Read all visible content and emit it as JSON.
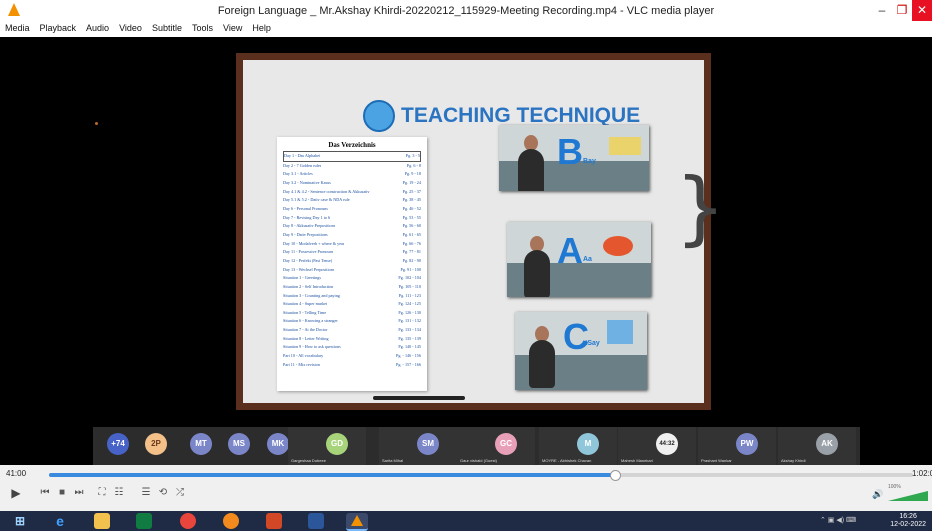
{
  "window": {
    "title": "Foreign Language _ Mr.Akshay Khirdi-20220212_115929-Meeting Recording.mp4 - VLC media player",
    "app_icon": "vlc-cone-icon",
    "minimize": "–",
    "maximize": "❐",
    "close": "✕"
  },
  "menu": [
    "Media",
    "Playback",
    "Audio",
    "Video",
    "Subtitle",
    "Tools",
    "View",
    "Help"
  ],
  "slide": {
    "heading": "TEACHING TECHNIQUE",
    "toc_title": "Das Verzeichnis",
    "toc": [
      {
        "l": "Day 1 - Das Alphabet",
        "r": "Pg. 3 - 5"
      },
      {
        "l": "Day 2 - 7 Golden rules",
        "r": "Pg. 6 - 8"
      },
      {
        "l": "Day 3.1 - Articles",
        "r": "Pg. 9 - 18"
      },
      {
        "l": "Day 3.2 - Nominative Kasus",
        "r": "Pg. 19 - 24"
      },
      {
        "l": "Day 4.1 & 4.2 - Sentence construction & Akkusativ",
        "r": "Pg. 25 - 37"
      },
      {
        "l": "Day 5.1 & 5.2 - Dativ case & NDA rule",
        "r": "Pg. 38 - 45"
      },
      {
        "l": "Day 6 - Personal Pronouns",
        "r": "Pg. 46 - 52"
      },
      {
        "l": "Day 7 - Revising Day 1 to 6",
        "r": "Pg. 53 - 55"
      },
      {
        "l": "Day 8 - Akkusativ Prepositions",
        "r": "Pg. 56 - 60"
      },
      {
        "l": "Day 9 - Dativ Prepositions",
        "r": "Pg. 61 - 65"
      },
      {
        "l": "Day 10 - Modalverb + where & year",
        "r": "Pg. 66 - 76"
      },
      {
        "l": "Day 11 - Possessive Pronouns",
        "r": "Pg. 77 - 81"
      },
      {
        "l": "Day 12 - Perfekt (Past Tense)",
        "r": "Pg. 82 - 90"
      },
      {
        "l": "Day 13 - Wechsel Prepositions",
        "r": "Pg. 91 - 100"
      },
      {
        "l": "Situation 1 - Greetings",
        "r": "Pg. 102 - 104"
      },
      {
        "l": "Situation 2 - Self Introduction",
        "r": "Pg. 105 - 110"
      },
      {
        "l": "Situation 3 - Counting and paying",
        "r": "Pg. 111 - 123"
      },
      {
        "l": "Situation 4 - Super market",
        "r": "Pg. 124 - 125"
      },
      {
        "l": "Situation 5 - Telling Time",
        "r": "Pg. 126 - 130"
      },
      {
        "l": "Situation 6 - Knowing a stranger",
        "r": "Pg. 131 - 132"
      },
      {
        "l": "Situation 7 - At the Doctor",
        "r": "Pg. 133 - 134"
      },
      {
        "l": "Situation 8 - Letter Writing",
        "r": "Pg. 135 - 139"
      },
      {
        "l": "Situation 9 - How to ask questions",
        "r": "Pg. 140 - 145"
      },
      {
        "l": "Part 10 - All vocabulary",
        "r": "Pg. - 146 - 156"
      },
      {
        "l": "Part 11 - Mix revision",
        "r": "Pg. - 157 - 166"
      }
    ],
    "cards": [
      {
        "letter": "B",
        "small": "Bay"
      },
      {
        "letter": "A",
        "small": "Aa"
      },
      {
        "letter": "C",
        "small": "tSay"
      }
    ]
  },
  "participants": {
    "more": "+74",
    "circles": [
      {
        "initials": "2P",
        "color": "#f3c08a",
        "text": "#6b3a1a"
      },
      {
        "initials": "MT",
        "color": "#7b86c9",
        "text": "#ffffff"
      },
      {
        "initials": "MS",
        "color": "#7b86c9",
        "text": "#ffffff"
      },
      {
        "initials": "MK",
        "color": "#7b86c9",
        "text": "#ffffff"
      }
    ],
    "tiles": [
      {
        "initials": "GD",
        "name": "Gargeshaa Dubeee",
        "color": "#a7d37a"
      },
      {
        "initials": "SM",
        "name": "Sarita Mihal",
        "color": "#7b86c9"
      },
      {
        "initials": "GC",
        "name": "Gaur vishald (Guest)",
        "color": "#e8a0b8"
      },
      {
        "initials": "M",
        "name": "MOYRE - Abhishek Chavan",
        "color": "#8fc6d9"
      },
      {
        "initials": "44:32",
        "name": "Mahesh Manekari",
        "color": "#f0f0f0"
      },
      {
        "initials": "PW",
        "name": "Prashant Wankar",
        "color": "#7b86c9"
      },
      {
        "initials": "AK",
        "name": "Akshay Khirdi",
        "color": "#9aa0a8"
      }
    ]
  },
  "player": {
    "elapsed": "41:00",
    "total": "1:02:0",
    "progress": 0.655,
    "volume_label": "100%",
    "volume": 1.0
  },
  "taskbar": {
    "time": "16:26",
    "date": "12-02-2022"
  },
  "colors": {
    "accent": "#3a8be0",
    "heading": "#2b74c2",
    "taskbar": "#1f2a44"
  }
}
